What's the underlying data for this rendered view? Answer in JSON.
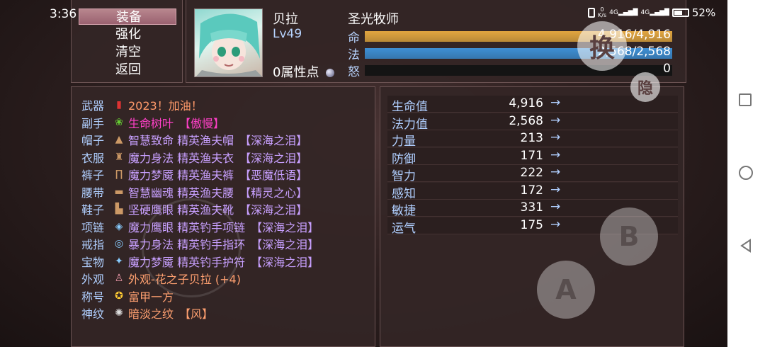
{
  "status": {
    "time": "3:36",
    "net_speed_top": "0",
    "net_speed_unit": "K/s",
    "signal1": "4G",
    "signal2": "4G",
    "battery": "52%"
  },
  "menu": {
    "items": [
      {
        "label": "装备",
        "selected": true
      },
      {
        "label": "强化"
      },
      {
        "label": "清空"
      },
      {
        "label": "返回"
      }
    ]
  },
  "character": {
    "name": "贝拉",
    "class": "圣光牧师",
    "level_prefix": "Lv",
    "level": "49",
    "attr_points": "0属性点",
    "bars": [
      {
        "letter": "命",
        "text": "4,916/4,916",
        "fraction": 1.0,
        "color": "#e2a640"
      },
      {
        "letter": "法",
        "text": "2,568/2,568",
        "fraction": 1.0,
        "color": "#3e8fd4"
      },
      {
        "letter": "怒",
        "text": "0",
        "fraction": 0.0,
        "color": "#c44"
      }
    ]
  },
  "equipment": [
    {
      "slot": "武器",
      "icon": "red-scroll-icon",
      "name": "2023！加油！",
      "suffix": "",
      "name_color": "#ff9a6a",
      "suffix_color": ""
    },
    {
      "slot": "副手",
      "icon": "leaf-icon",
      "name": "生命树叶",
      "suffix": "【傲慢】",
      "name_color": "#ff40c8",
      "suffix_color": "#ff40c8"
    },
    {
      "slot": "帽子",
      "icon": "hat-icon",
      "name": "智慧致命 精英渔夫帽",
      "suffix": "【深海之泪】",
      "name_color": "#c8a0ff",
      "suffix_color": "#c8a0ff"
    },
    {
      "slot": "衣服",
      "icon": "robe-icon",
      "name": "魔力身法 精英渔夫衣",
      "suffix": "【深海之泪】",
      "name_color": "#c8a0ff",
      "suffix_color": "#c8a0ff"
    },
    {
      "slot": "裤子",
      "icon": "pants-icon",
      "name": "魔力梦魇 精英渔夫裤",
      "suffix": "【恶魔低语】",
      "name_color": "#c8a0ff",
      "suffix_color": "#c8a0ff"
    },
    {
      "slot": "腰带",
      "icon": "belt-icon",
      "name": "智慧幽魂 精英渔夫腰",
      "suffix": "【精灵之心】",
      "name_color": "#c8a0ff",
      "suffix_color": "#c8a0ff"
    },
    {
      "slot": "鞋子",
      "icon": "boots-icon",
      "name": "坚硬鹰眼 精英渔夫靴",
      "suffix": "【深海之泪】",
      "name_color": "#c8a0ff",
      "suffix_color": "#c8a0ff"
    },
    {
      "slot": "项链",
      "icon": "necklace-icon",
      "name": "魔力鹰眼 精英钓手项链",
      "suffix": "【深海之泪】",
      "name_color": "#c8a0ff",
      "suffix_color": "#c8a0ff"
    },
    {
      "slot": "戒指",
      "icon": "ring-icon",
      "name": "暴力身法 精英钓手指环",
      "suffix": "【深海之泪】",
      "name_color": "#c8a0ff",
      "suffix_color": "#c8a0ff"
    },
    {
      "slot": "宝物",
      "icon": "treasure-icon",
      "name": "魔力梦魇 精英钓手护符",
      "suffix": "【深海之泪】",
      "name_color": "#c8a0ff",
      "suffix_color": "#c8a0ff"
    },
    {
      "slot": "外观",
      "icon": "costume-icon",
      "name": "外观-花之子贝拉 (+4)",
      "suffix": "",
      "name_color": "#ffa070",
      "suffix_color": ""
    },
    {
      "slot": "称号",
      "icon": "medal-icon",
      "name": "富甲一方",
      "suffix": "",
      "name_color": "#ffa070",
      "suffix_color": ""
    },
    {
      "slot": "神纹",
      "icon": "rune-icon",
      "name": "暗淡之纹",
      "suffix": "【风】",
      "name_color": "#ffa070",
      "suffix_color": "#ffa070"
    }
  ],
  "stats": [
    {
      "name": "生命值",
      "value": "4,916",
      "arrow": "→"
    },
    {
      "name": "法力值",
      "value": "2,568",
      "arrow": "→"
    },
    {
      "name": "力量",
      "value": "213",
      "arrow": "→"
    },
    {
      "name": "防御",
      "value": "171",
      "arrow": "→"
    },
    {
      "name": "智力",
      "value": "222",
      "arrow": "→"
    },
    {
      "name": "感知",
      "value": "172",
      "arrow": "→"
    },
    {
      "name": "敏捷",
      "value": "331",
      "arrow": "→"
    },
    {
      "name": "运气",
      "value": "175",
      "arrow": "→"
    }
  ],
  "overlay_buttons": {
    "swap": "换",
    "hide": "隐",
    "a": "A",
    "b": "B"
  }
}
